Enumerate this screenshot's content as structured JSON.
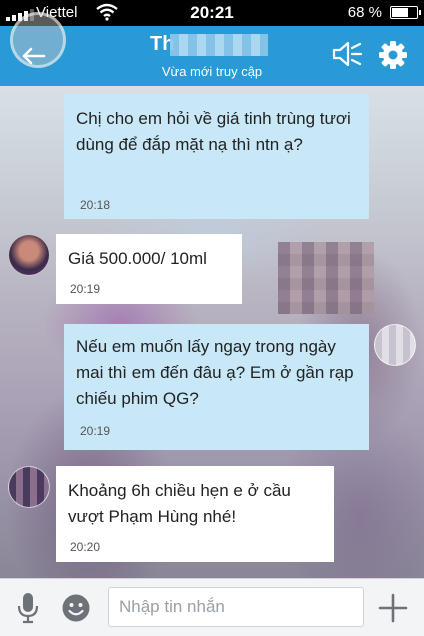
{
  "status_bar": {
    "carrier": "Viettel",
    "time": "20:21",
    "battery_percent": "68 %",
    "battery_level": 0.68
  },
  "header": {
    "contact_name_visible": "Th",
    "presence": "Vừa mới truy cập",
    "icons": [
      "back-icon",
      "speaker-icon",
      "gear-icon"
    ]
  },
  "messages": [
    {
      "direction": "outgoing",
      "text": "Chị cho em hỏi về giá tinh trùng tươi dùng để đắp mặt nạ thì ntn ạ?",
      "time": "20:18"
    },
    {
      "direction": "incoming",
      "text": "Giá 500.000/ 10ml",
      "time": "20:19"
    },
    {
      "direction": "outgoing",
      "text": "Nếu em muốn lấy ngay trong ngày mai thì em đến đâu ạ? Em ở gần rạp chiếu phim QG?",
      "time": "20:19"
    },
    {
      "direction": "incoming",
      "text": "Khoảng 6h chiều hẹn e ở cầu vượt Phạm Hùng nhé!",
      "time": "20:20"
    }
  ],
  "input_bar": {
    "placeholder": "Nhập tin nhắn",
    "icons": [
      "microphone-icon",
      "emoji-icon",
      "plus-icon"
    ]
  },
  "colors": {
    "header": "#2a9ad6",
    "outgoing_bubble": "#c8e8f8",
    "incoming_bubble": "#ffffff"
  }
}
